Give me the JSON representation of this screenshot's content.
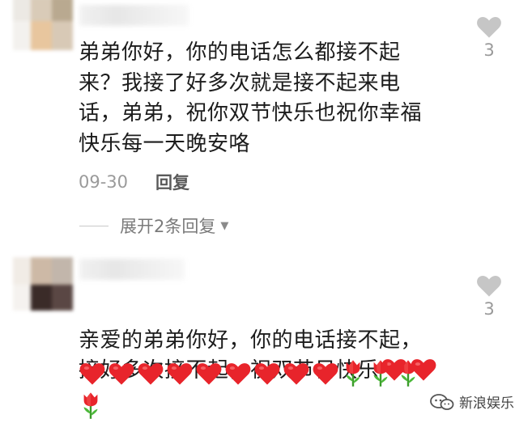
{
  "comments": [
    {
      "text": "弟弟你好，你的电话怎么都接不起\n来？我接了好多次就是接不起来电\n话，弟弟，祝你双节快乐也祝你幸福\n快乐每一天晚安咯",
      "likes": "3",
      "date": "09-30",
      "reply_label": "回复",
      "expand_label": "展开2条回复",
      "avatar_icon": "blurred-avatar",
      "like_icon": "heart-outline-icon"
    },
    {
      "text": "亲爱的弟弟你好，你的电话接不起，\n接好多次接不起，祝双节日快乐",
      "likes": "3",
      "avatar_icon": "blurred-avatar",
      "like_icon": "heart-outline-icon",
      "inline_emoji": [
        "red-heart",
        "red-heart"
      ],
      "emoji_row": [
        "red-heart",
        "red-heart",
        "red-heart",
        "red-heart",
        "red-heart",
        "red-heart",
        "red-heart",
        "red-heart",
        "red-heart",
        "tulip",
        "tulip",
        "tulip"
      ],
      "emoji_row2": [
        "tulip"
      ]
    }
  ],
  "watermark": {
    "label": "新浪娱乐",
    "icon": "weibo-chat-icon"
  },
  "colors": {
    "heart": "#e8242b",
    "like_icon": "#c6c6c6",
    "meta_text": "#9a9a9a"
  }
}
